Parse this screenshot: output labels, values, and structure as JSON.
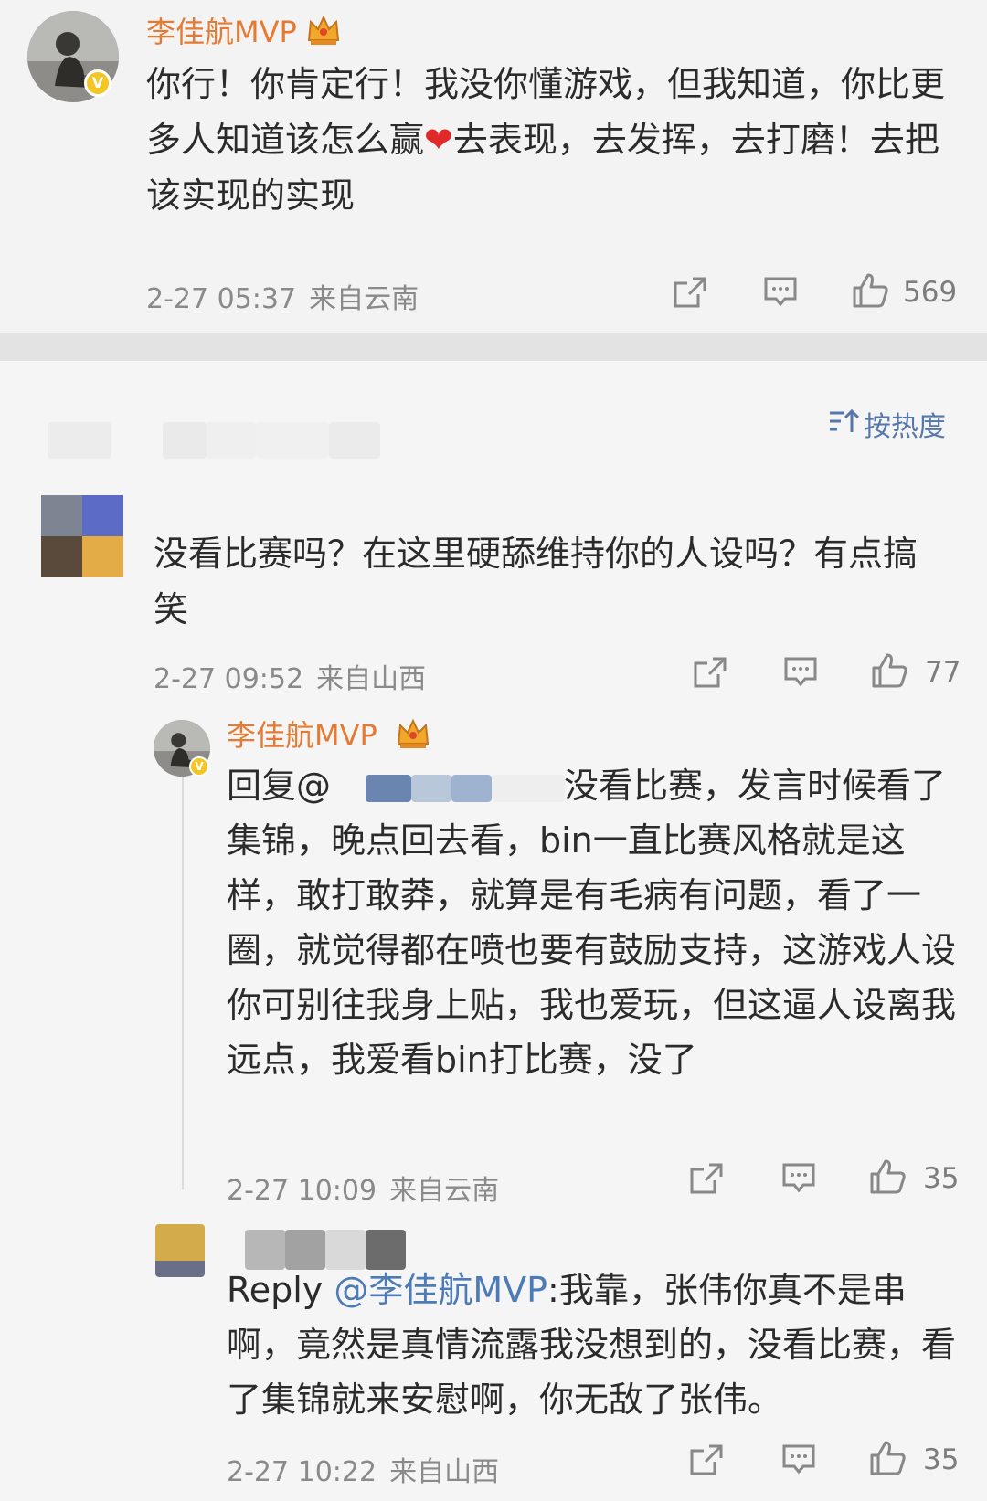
{
  "colors": {
    "username": "#e77a33",
    "mention": "#4c7bb8",
    "heart": "#e02a2a",
    "meta": "#8a8a8a",
    "badge": "#f3c623"
  },
  "top_post": {
    "author": "李佳航MVP",
    "text_parts": [
      "你行！你肯定行！我没你懂游戏，但我知道，你比更多人知道该怎么赢",
      "❤",
      "去表现，去发挥，去打磨！去把该实现的实现"
    ],
    "time": "2-27 05:37",
    "location": "来自云南",
    "likes": "569",
    "icons": [
      "crown-icon",
      "verified-badge-icon",
      "share-icon",
      "comment-icon",
      "like-icon"
    ]
  },
  "sort_label": "按热度",
  "comment_1": {
    "text": "没看比赛吗？在这里硬舔维持你的人设吗？有点搞笑",
    "time": "2-27 09:52",
    "location": "来自山西",
    "likes": "77"
  },
  "reply_1": {
    "author": "李佳航MVP",
    "prefix": "回复@",
    "text": "没看比赛，发言时候看了集锦，晚点回去看，bin一直比赛风格就是这样，敢打敢莽，就算是有毛病有问题，看了一圈，就觉得都在喷也要有鼓励支持，这游戏人设你可别往我身上贴，我也爱玩，但这逼人设离我远点，我爱看bin打比赛，没了",
    "time": "2-27 10:09",
    "location": "来自云南",
    "likes": "35"
  },
  "reply_2": {
    "prefix": "Reply ",
    "mention": "@李佳航MVP",
    "text": ":我靠，张伟你真不是串啊，竟然是真情流露我没想到的，没看比赛，看了集锦就来安慰啊，你无敌了张伟。",
    "time": "2-27 10:22",
    "location": "来自山西",
    "likes": "35"
  }
}
